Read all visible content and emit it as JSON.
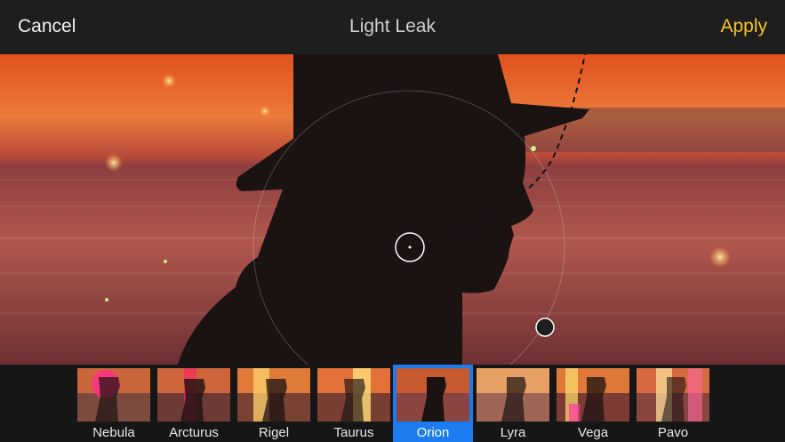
{
  "header": {
    "cancel_label": "Cancel",
    "title": "Light Leak",
    "apply_label": "Apply"
  },
  "colors": {
    "apply": "#f5c52a",
    "selected": "#1a7cf0",
    "header_bg": "#1e1e1e"
  },
  "filters": {
    "selected": "Orion",
    "items": [
      {
        "label": "Nebula"
      },
      {
        "label": "Arcturus"
      },
      {
        "label": "Rigel"
      },
      {
        "label": "Taurus"
      },
      {
        "label": "Orion"
      },
      {
        "label": "Lyra"
      },
      {
        "label": "Vega"
      },
      {
        "label": "Pavo"
      }
    ]
  }
}
